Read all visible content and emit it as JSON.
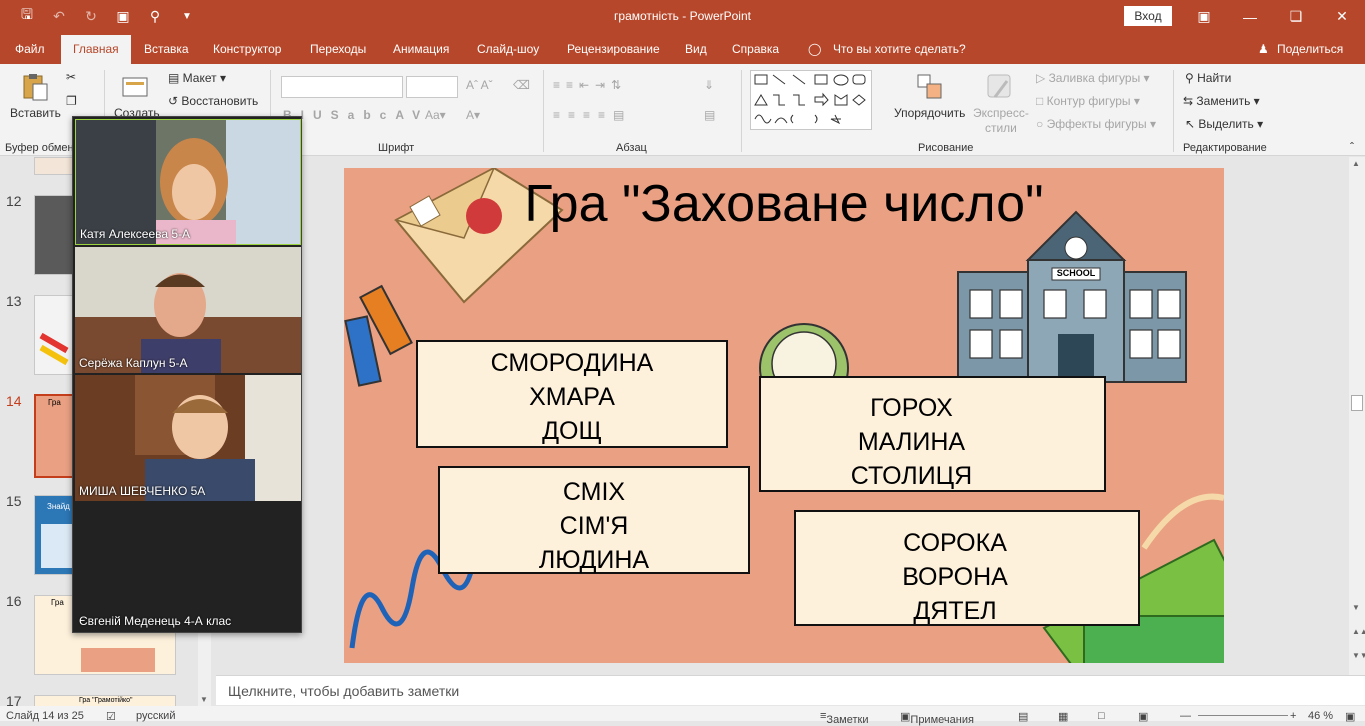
{
  "window": {
    "title": "грамотність  -  PowerPoint",
    "signin": "Вход"
  },
  "tabs": [
    {
      "label": "Файл"
    },
    {
      "label": "Главная"
    },
    {
      "label": "Вставка"
    },
    {
      "label": "Конструктор"
    },
    {
      "label": "Переходы"
    },
    {
      "label": "Анимация"
    },
    {
      "label": "Слайд-шоу"
    },
    {
      "label": "Рецензирование"
    },
    {
      "label": "Вид"
    },
    {
      "label": "Справка"
    }
  ],
  "tellme": "Что вы хотите сделать?",
  "share": "Поделиться",
  "ribbon": {
    "paste": "Вставить",
    "clipboard_group": "Буфер обмен",
    "create": "Создать",
    "layout": "Макет",
    "reset": "Восстановить",
    "font_group": "Шрифт",
    "paragraph_group": "Абзац",
    "arrange": "Упорядочить",
    "express_styles": "Экспресс-\nстили",
    "shape_fill": "Заливка фигуры",
    "shape_outline": "Контур фигуры",
    "shape_effects": "Эффекты фигуры",
    "drawing_group": "Рисование",
    "find": "Найти",
    "replace": "Заменить",
    "select": "Выделить",
    "editing_group": "Редактирование"
  },
  "slides_panel": {
    "numbers": [
      "12",
      "13",
      "14",
      "15",
      "16",
      "17"
    ],
    "thumb_texts": {
      "t14": "Гра",
      "t15": "Знайд",
      "t16": "Гра",
      "t17": "Гра \"Грамотійко\""
    }
  },
  "video": [
    {
      "name": "Катя Алексеева 5-А"
    },
    {
      "name": "Серёжа Каплун 5-А"
    },
    {
      "name": "МИША ШЕВЧЕНКО 5А"
    },
    {
      "name": "Євгеній Меденець 4-А клас"
    }
  ],
  "slide": {
    "title": "Гра \"Заховане число\"",
    "school_sign": "SCHOOL",
    "cards": [
      {
        "lines": [
          "СМОРОДИНА",
          "ХМАРА",
          "ДОЩ"
        ]
      },
      {
        "lines": [
          "СМІХ",
          "СІМ'Я",
          "ЛЮДИНА"
        ]
      },
      {
        "lines": [
          "ГОРОХ",
          "МАЛИНА",
          "СТОЛИЦЯ"
        ]
      },
      {
        "lines": [
          "СОРОКА",
          "ВОРОНА",
          "ДЯТЕЛ"
        ]
      }
    ]
  },
  "notes_placeholder": "Щелкните, чтобы добавить заметки",
  "status": {
    "slide": "Слайд 14 из 25",
    "language": "русский",
    "notes": "Заметки",
    "comments": "Примечания",
    "zoom": "46 %"
  },
  "colors": {
    "accent": "#b7472a",
    "slide_bg": "#eaa083",
    "card_bg": "#fdf1dc"
  }
}
